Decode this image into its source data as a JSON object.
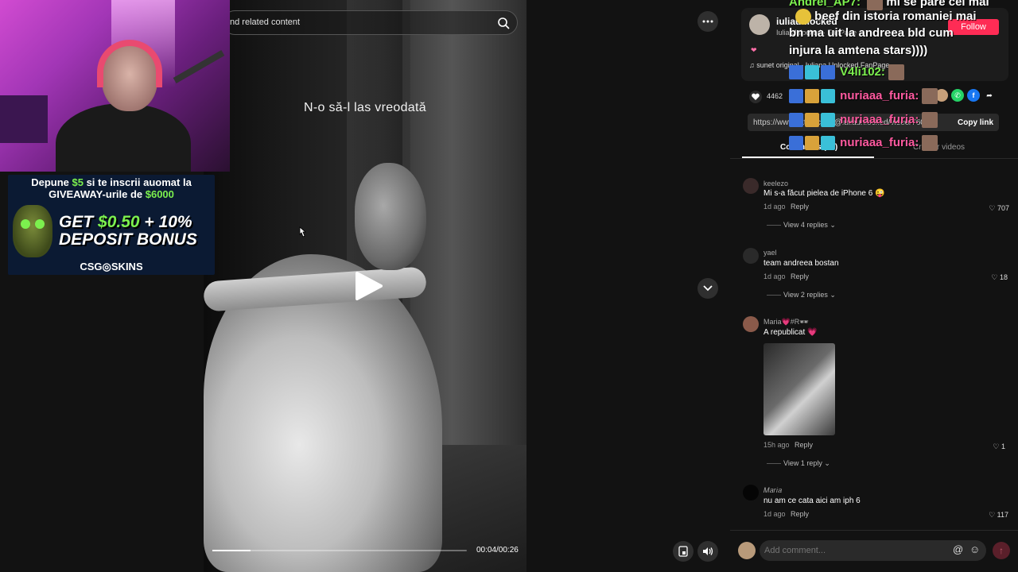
{
  "video": {
    "search_text": "nd related content",
    "caption": "N-o să-l las vreodată",
    "progress_fraction": 0.15,
    "time": "00:04/00:26"
  },
  "webcam_ad": {
    "line1_a": "Depune ",
    "line1_b": "$5",
    "line1_c": " si te inscrii auomat la",
    "line2_a": "GIVEAWAY-urile de ",
    "line2_b": "$6000",
    "big1_a": "GET ",
    "big1_b": "$0.50",
    "big1_c": " + 10%",
    "big2": "DEPOSIT BONUS",
    "logo": "CSG◎SKINS"
  },
  "author": {
    "name": "iuliaunlocked",
    "sub": "Iulia Unlocked · FanPage",
    "follow": "Follow",
    "sound": "♫  sunet original - Iuliana Unlocked FanPage",
    "likes": "4462",
    "link": "https://www.tiktok.com/@iuliaunlocked/video/7606",
    "copy_link": "Copy link"
  },
  "tabs": {
    "comments": "Comments (96)",
    "creator": "Creator videos"
  },
  "comments": [
    {
      "user": "keelezo",
      "text": "Mi s-a făcut pielea de iPhone 6 😜",
      "time": "1d ago",
      "reply": "Reply",
      "likes": "707",
      "view": "View 4 replies"
    },
    {
      "user": "yael",
      "text": "team andreea bostan",
      "time": "1d ago",
      "reply": "Reply",
      "likes": "18",
      "view": "View 2 replies"
    },
    {
      "user": "Maria💗#R🕶",
      "text": "A republicat 💗",
      "time": "15h ago",
      "reply": "Reply",
      "likes": "1",
      "view": "View 1 reply"
    },
    {
      "user": "𝑀𝑎𝑟𝑖𝑎",
      "text": "nu am ce cata aici am iph 6",
      "time": "1d ago",
      "reply": "Reply",
      "likes": "117"
    }
  ],
  "comment_input": {
    "placeholder": "Add comment..."
  },
  "chat": [
    {
      "name": "Andrei_AP7:",
      "msg": "mi se pare cel mai",
      "color": "green"
    },
    {
      "name": "",
      "msg": "beef din istoria romaniei mai",
      "color": "green"
    },
    {
      "name": "",
      "msg": "bn ma uit la andreea bld cum",
      "color": "green"
    },
    {
      "name": "",
      "msg": "injura la amtena stars))))",
      "color": "green"
    },
    {
      "name": "V4li102:",
      "msg": "",
      "color": "green"
    },
    {
      "name": "nuriaaa_furia:",
      "msg": "",
      "color": "pink"
    },
    {
      "name": "nuriaaa_furia:",
      "msg": "",
      "color": "pink"
    },
    {
      "name": "nuriaaa_furia:",
      "msg": "",
      "color": "pink"
    }
  ]
}
